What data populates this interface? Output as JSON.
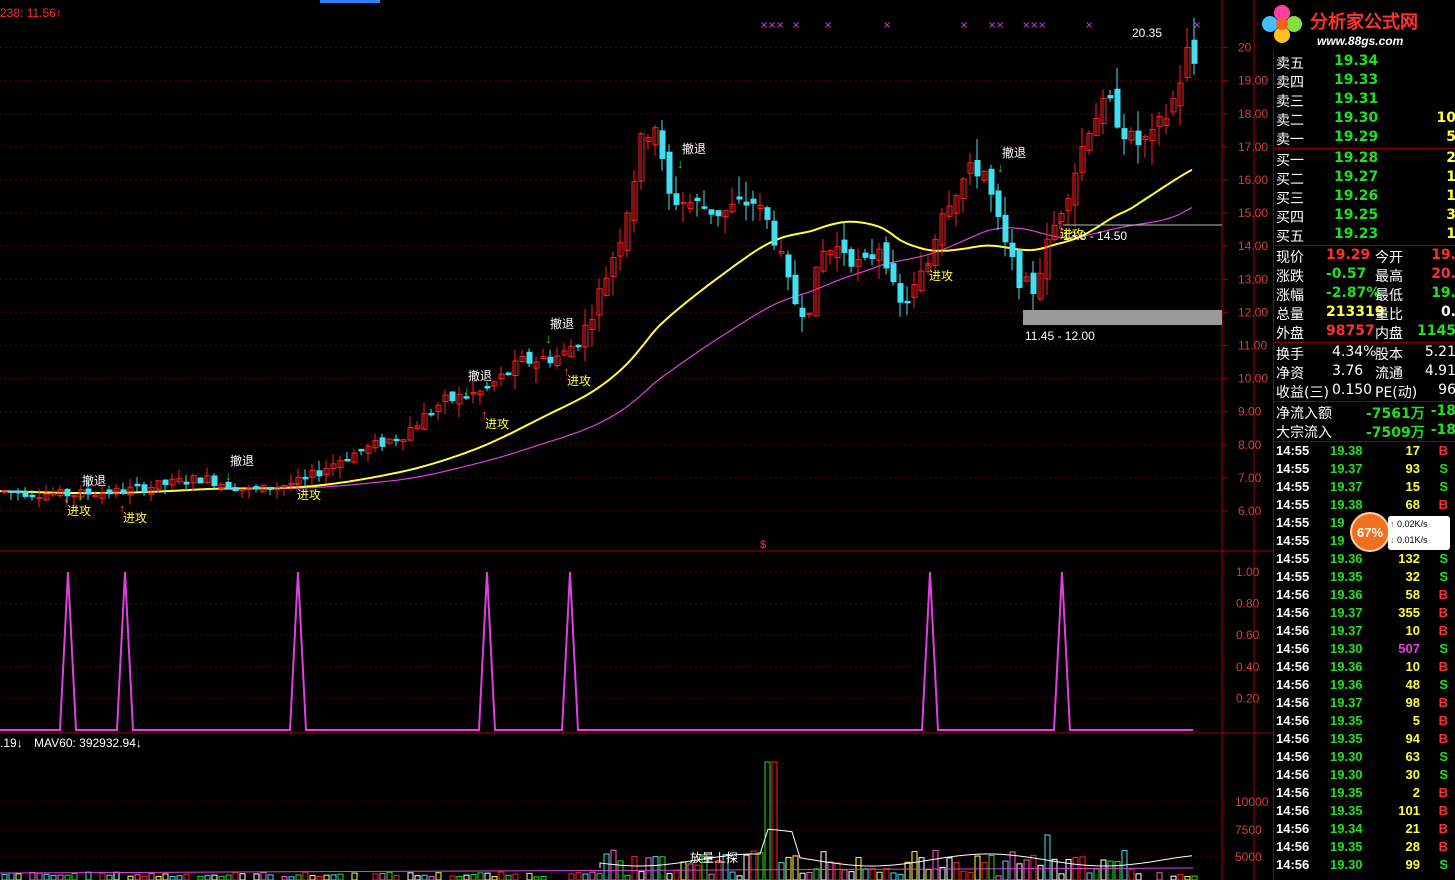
{
  "header": {
    "ma_readout": "238: 11.56",
    "mav_readout": ".19",
    "mav60_readout": "MAV60: 392932.94"
  },
  "price_axis": [
    "20",
    "19.00",
    "18.00",
    "17.00",
    "16.00",
    "15.00",
    "14.00",
    "13.00",
    "12.00",
    "11.00",
    "10.00",
    "9.00",
    "8.00",
    "7.00",
    "6.00"
  ],
  "ind_axis": [
    "1.00",
    "0.80",
    "0.60",
    "0.40",
    "0.20"
  ],
  "vol_axis": [
    "10000",
    "7500",
    "5000"
  ],
  "annotations": {
    "retreat": "撤退",
    "attack": "进攻",
    "high_price": "20.35",
    "range_upper": "13.8 - 14.50",
    "range_upper_prefix": "",
    "range_lower": "11.45 - 12.00",
    "volume_note": "放量上探",
    "dollar_mark": "$"
  },
  "logo": {
    "title": "分析家公式网",
    "url": "www.88gs.com"
  },
  "quote": {
    "asks": [
      {
        "label": "卖五",
        "price": "19.34",
        "vol": ""
      },
      {
        "label": "卖四",
        "price": "19.33",
        "vol": ""
      },
      {
        "label": "卖三",
        "price": "19.31",
        "vol": ""
      },
      {
        "label": "卖二",
        "price": "19.30",
        "vol": "10"
      },
      {
        "label": "卖一",
        "price": "19.29",
        "vol": "5"
      }
    ],
    "bids": [
      {
        "label": "买一",
        "price": "19.28",
        "vol": "2"
      },
      {
        "label": "买二",
        "price": "19.27",
        "vol": "1"
      },
      {
        "label": "买三",
        "price": "19.26",
        "vol": "1"
      },
      {
        "label": "买四",
        "price": "19.25",
        "vol": "3"
      },
      {
        "label": "买五",
        "price": "19.23",
        "vol": "1"
      }
    ],
    "stats": [
      {
        "l1": "现价",
        "v1": "19.29",
        "l2": "今开",
        "v2": "19.",
        "c1": "#ff3030",
        "c2": "#ff3030"
      },
      {
        "l1": "涨跌",
        "v1": "-0.57",
        "l2": "最高",
        "v2": "20.",
        "c1": "#20e020",
        "c2": "#ff3030"
      },
      {
        "l1": "涨幅",
        "v1": "-2.87%",
        "l2": "最低",
        "v2": "19.",
        "c1": "#20e020",
        "c2": "#20e020"
      },
      {
        "l1": "总量",
        "v1": "213319",
        "l2": "量比",
        "v2": "0.",
        "c1": "#ffff40",
        "c2": "#ffffff"
      },
      {
        "l1": "外盘",
        "v1": "98757",
        "l2": "内盘",
        "v2": "1145",
        "c1": "#ff3030",
        "c2": "#20e020"
      }
    ],
    "stats2": [
      {
        "l1": "换手",
        "v1": "4.34%",
        "l2": "股本",
        "v2": "5.21"
      },
      {
        "l1": "净资",
        "v1": "3.76",
        "l2": "流通",
        "v2": "4.91"
      },
      {
        "l1": "收益(三)",
        "v1": "0.150",
        "l2": "PE(动)",
        "v2": "96"
      }
    ],
    "flows": [
      {
        "l1": "净流入额",
        "v1": "-7561万",
        "v2": "-18"
      },
      {
        "l1": "大宗流入",
        "v1": "-7509万",
        "v2": "-18"
      }
    ]
  },
  "ticks": [
    {
      "t": "14:55",
      "p": "19.38",
      "v": "17",
      "s": "B",
      "pc": "#ff3030",
      "vc": "#ffff40"
    },
    {
      "t": "14:55",
      "p": "19.37",
      "v": "93",
      "s": "S",
      "pc": "#ff3030",
      "vc": "#ffff40"
    },
    {
      "t": "14:55",
      "p": "19.37",
      "v": "15",
      "s": "S",
      "pc": "#ff3030",
      "vc": "#ffff40"
    },
    {
      "t": "14:55",
      "p": "19.38",
      "v": "68",
      "s": "B",
      "pc": "#ff3030",
      "vc": "#ffff40"
    },
    {
      "t": "14:55",
      "p": "19",
      "v": "",
      "s": "",
      "pc": "#ff3030",
      "vc": "#ffff40"
    },
    {
      "t": "14:55",
      "p": "19",
      "v": "",
      "s": "",
      "pc": "#ff3030",
      "vc": "#ffff40"
    },
    {
      "t": "14:55",
      "p": "19.36",
      "v": "132",
      "s": "S",
      "pc": "#ff3030",
      "vc": "#ffff40"
    },
    {
      "t": "14:55",
      "p": "19.35",
      "v": "32",
      "s": "S",
      "pc": "#ff3030",
      "vc": "#ffff40"
    },
    {
      "t": "14:56",
      "p": "19.36",
      "v": "58",
      "s": "B",
      "pc": "#ff3030",
      "vc": "#ffff40"
    },
    {
      "t": "14:56",
      "p": "19.37",
      "v": "355",
      "s": "B",
      "pc": "#ff3030",
      "vc": "#ffff40"
    },
    {
      "t": "14:56",
      "p": "19.37",
      "v": "10",
      "s": "B",
      "pc": "#ff3030",
      "vc": "#ffff40"
    },
    {
      "t": "14:56",
      "p": "19.30",
      "v": "507",
      "s": "S",
      "pc": "#ff3030",
      "vc": "#e040e0"
    },
    {
      "t": "14:56",
      "p": "19.36",
      "v": "10",
      "s": "B",
      "pc": "#ff3030",
      "vc": "#ffff40"
    },
    {
      "t": "14:56",
      "p": "19.36",
      "v": "48",
      "s": "S",
      "pc": "#ff3030",
      "vc": "#ffff40"
    },
    {
      "t": "14:56",
      "p": "19.37",
      "v": "98",
      "s": "B",
      "pc": "#ff3030",
      "vc": "#ffff40"
    },
    {
      "t": "14:56",
      "p": "19.35",
      "v": "5",
      "s": "B",
      "pc": "#ff3030",
      "vc": "#ffff40"
    },
    {
      "t": "14:56",
      "p": "19.35",
      "v": "94",
      "s": "B",
      "pc": "#ff3030",
      "vc": "#ffff40"
    },
    {
      "t": "14:56",
      "p": "19.30",
      "v": "63",
      "s": "S",
      "pc": "#ff3030",
      "vc": "#ffff40"
    },
    {
      "t": "14:56",
      "p": "19.30",
      "v": "30",
      "s": "S",
      "pc": "#ff3030",
      "vc": "#ffff40"
    },
    {
      "t": "14:56",
      "p": "19.35",
      "v": "2",
      "s": "B",
      "pc": "#ff3030",
      "vc": "#ffff40"
    },
    {
      "t": "14:56",
      "p": "19.35",
      "v": "101",
      "s": "B",
      "pc": "#ff3030",
      "vc": "#ffff40"
    },
    {
      "t": "14:56",
      "p": "19.34",
      "v": "21",
      "s": "B",
      "pc": "#ff3030",
      "vc": "#ffff40"
    },
    {
      "t": "14:56",
      "p": "19.35",
      "v": "28",
      "s": "B",
      "pc": "#ff3030",
      "vc": "#ffff40"
    },
    {
      "t": "14:56",
      "p": "19.30",
      "v": "99",
      "s": "S",
      "pc": "#ff3030",
      "vc": "#ffff40"
    }
  ],
  "speed_badge": {
    "percent": "67%",
    "up": "0.02K/s",
    "down": "0.01K/s"
  },
  "chart_data": {
    "type": "candlestick",
    "price_range": [
      5.5,
      20.5
    ],
    "signal_days": [
      68,
      125,
      298,
      487,
      570,
      930,
      1062
    ],
    "colors": {
      "up": "#ff2020",
      "down": "#40e0f0",
      "ma_short": "#ffffff",
      "ma_mid": "#20c020",
      "ma_long": "#ffff40",
      "ma_longest": "#e040e0",
      "signal": "#e040e0"
    }
  }
}
